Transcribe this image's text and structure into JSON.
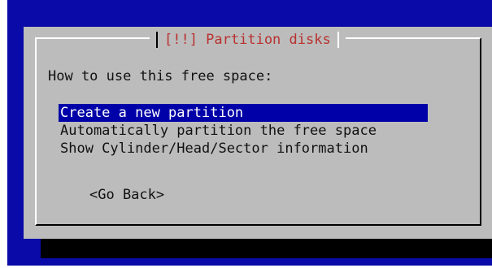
{
  "dialog": {
    "title": "[!!] Partition disks",
    "question": "How to use this free space:",
    "options": [
      {
        "label": "Create a new partition",
        "selected": true
      },
      {
        "label": "Automatically partition the free space",
        "selected": false
      },
      {
        "label": "Show Cylinder/Head/Sector information",
        "selected": false
      }
    ],
    "go_back_label": "<Go Back>"
  },
  "colors": {
    "background": "#0a0aa8",
    "dialog": "#bcbcbc",
    "title_text": "#b8312f",
    "selection": "#0000a8"
  }
}
